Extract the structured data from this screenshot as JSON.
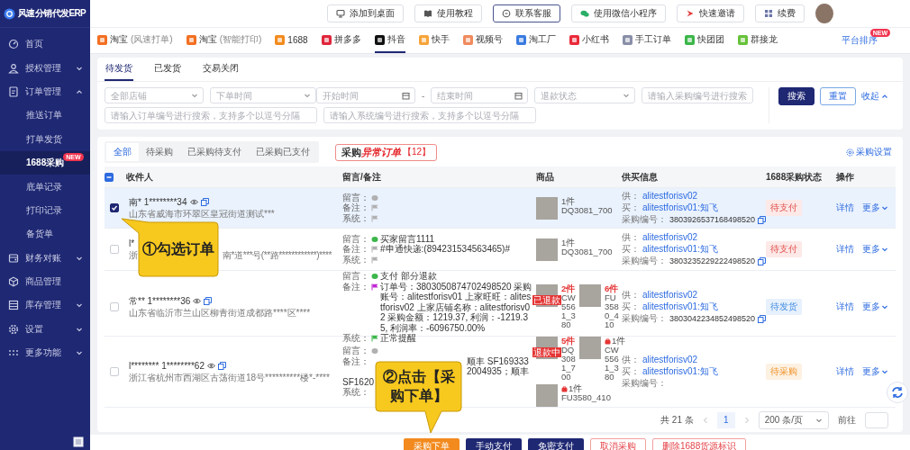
{
  "sidebar": {
    "logo": "风速分销代发ERP",
    "items": [
      {
        "label": "首页",
        "selected": false
      },
      {
        "label": "授权管理",
        "selected": false,
        "expanded": false
      },
      {
        "label": "订单管理",
        "selected": false,
        "expanded": true,
        "children": [
          {
            "label": "推送订单",
            "selected": false
          },
          {
            "label": "打单发货",
            "selected": false
          },
          {
            "label": "1688采购",
            "selected": true,
            "badge": "NEW"
          },
          {
            "label": "底单记录",
            "selected": false
          },
          {
            "label": "打印记录",
            "selected": false
          },
          {
            "label": "备货单",
            "selected": false
          }
        ]
      },
      {
        "label": "财务对账",
        "selected": false,
        "expanded": false
      },
      {
        "label": "商品管理",
        "selected": false
      },
      {
        "label": "库存管理",
        "selected": false,
        "expanded": false
      },
      {
        "label": "设置",
        "selected": false,
        "expanded": false
      },
      {
        "label": "更多功能",
        "selected": false,
        "expanded": false
      }
    ]
  },
  "top_buttons": [
    {
      "label": "添加到桌面",
      "selected": false
    },
    {
      "label": "使用教程",
      "selected": false
    },
    {
      "label": "联系客服",
      "selected": true
    },
    {
      "label": "使用微信小程序",
      "selected": false
    },
    {
      "label": "快速邀请",
      "selected": false
    },
    {
      "label": "续费",
      "selected": false
    }
  ],
  "platforms": [
    {
      "label": "淘宝",
      "sub": "(风速打单)",
      "color": "#f36f21",
      "selected": false
    },
    {
      "label": "淘宝",
      "sub": "(智能打印)",
      "color": "#f36f21",
      "selected": false
    },
    {
      "label": "1688",
      "color": "#f38b1e",
      "selected": false
    },
    {
      "label": "拼多多",
      "color": "#e0263c",
      "selected": false
    },
    {
      "label": "抖音",
      "color": "#111111",
      "selected": true
    },
    {
      "label": "快手",
      "color": "#f7a43a",
      "selected": false
    },
    {
      "label": "视频号",
      "color": "#f08a5d",
      "selected": false
    },
    {
      "label": "淘工厂",
      "color": "#3a7be0",
      "selected": false
    },
    {
      "label": "小红书",
      "color": "#ea2a3a",
      "selected": false
    },
    {
      "label": "手工订单",
      "color": "#8a8fa8",
      "selected": false
    },
    {
      "label": "快团团",
      "color": "#3cb64a",
      "selected": false
    },
    {
      "label": "群接龙",
      "color": "#67c23a",
      "selected": false
    }
  ],
  "platform_sort": {
    "label": "平台排序",
    "badge": "NEW"
  },
  "order_tabs": [
    {
      "label": "待发货",
      "selected": true
    },
    {
      "label": "已发货",
      "selected": false
    },
    {
      "label": "交易关闭",
      "selected": false
    }
  ],
  "filters": {
    "store": {
      "placeholder": "全部店铺"
    },
    "time_type": {
      "placeholder": "下单时间"
    },
    "start": {
      "placeholder": "开始时间"
    },
    "separator": "-",
    "end": {
      "placeholder": "结束时间"
    },
    "refund": {
      "placeholder": "退款状态"
    },
    "purchase_no": {
      "placeholder": "请输入采购编号进行搜索"
    },
    "order_no": {
      "placeholder": "请输入订单编号进行搜索，支持多个以逗号分隔"
    },
    "system_no": {
      "placeholder": "请输入系统编号进行搜索，支持多个以逗号分隔"
    },
    "search": "搜索",
    "reset": "重置",
    "collapse": "收起"
  },
  "status_tabs": [
    {
      "label": "全部",
      "selected": true
    },
    {
      "label": "待采购",
      "selected": false
    },
    {
      "label": "已采购待支付",
      "selected": false
    },
    {
      "label": "已采购已支付",
      "selected": false
    }
  ],
  "abnormal": {
    "title": "采购",
    "title_highlight": "异常订单",
    "count": "【12】"
  },
  "purchase_settings": "采购设置",
  "table": {
    "select_all": {
      "indeterminate": true
    },
    "columns": [
      "收件人",
      "留言/备注",
      "商品",
      "供买信息",
      "1688采购状态",
      "操作"
    ],
    "rows": [
      {
        "checked": true,
        "recipient": {
          "name": "南* 1********34",
          "address": "山东省威海市环翠区皇冠街道测试***"
        },
        "remarks": [
          {
            "label": "留言：",
            "kind": "message",
            "color": "#b0b0b0"
          },
          {
            "label": "备注：",
            "kind": "flag",
            "color": "#b0b0b0"
          },
          {
            "label": "系统：",
            "kind": "flag",
            "color": "#b0b0b0"
          }
        ],
        "products": [
          {
            "qty": "1件",
            "sku": "DQ3081_700",
            "highlight": false
          }
        ],
        "supplier": {
          "supply_label": "供：",
          "supply": "alitestforisv02",
          "buy_label": "买：",
          "buy": "alitestforisv01:知飞",
          "no_label": "采购编号：",
          "no": "3803926537168498520"
        },
        "status": {
          "label": "待支付",
          "kind": "pending_pay"
        },
        "actions": {
          "detail": "详情",
          "more": "更多"
        }
      },
      {
        "checked": false,
        "recipient": {
          "name": "l*",
          "address": "浙",
          "address_rest": "南*道***号(**路************)****"
        },
        "remarks": [
          {
            "label": "留言：",
            "kind": "message",
            "color": "#3cb64a",
            "text": "买家留言1111"
          },
          {
            "label": "备注：",
            "kind": "flag",
            "color": "#b0b0b0",
            "text": "#申通快递:(894231534563465)#"
          },
          {
            "label": "系统：",
            "kind": "flag",
            "color": "#b0b0b0"
          }
        ],
        "products": [
          {
            "qty": "1件",
            "sku": "DQ3081_700",
            "highlight": false
          }
        ],
        "supplier": {
          "supply_label": "供：",
          "supply": "alitestforisv02",
          "buy_label": "买：",
          "buy": "alitestforisv01:知飞",
          "no_label": "采购编号：",
          "no": "3803235229222498520"
        },
        "status": {
          "label": "待支付",
          "kind": "pending_pay"
        },
        "actions": {
          "detail": "详情",
          "more": "更多"
        }
      },
      {
        "checked": false,
        "recipient": {
          "name": "常** 1********36",
          "address": "山东省临沂市兰山区柳青街道成都路****区****"
        },
        "remarks": [
          {
            "label": "留言：",
            "kind": "message",
            "color": "#3cb64a",
            "text": "支付 部分退款"
          },
          {
            "label": "备注：",
            "kind": "flag",
            "color": "#c026d3",
            "text": "订单号：3803050874702498520 采购账号：alitestforisv01 上家旺旺：alitestforisv02 上家店铺名称：alitestforisv02 采购金额：1219.37, 利润：-1219.35, 利润率：-6096750.00%"
          },
          {
            "label": "系统：",
            "kind": "flag",
            "color": "#3cb64a",
            "text": "正常提醒"
          }
        ],
        "products": [
          {
            "badge": "已退款",
            "qty": "2件",
            "sku": "CW5561_380",
            "highlight": true
          },
          {
            "qty": "6件",
            "sku": "FU3580_410",
            "highlight": true
          }
        ],
        "supplier": {
          "supply_label": "供：",
          "supply": "alitestforisv02",
          "buy_label": "买：",
          "buy": "alitestforisv01:知飞",
          "no_label": "采购编号：",
          "no": "3803042234852498520"
        },
        "status": {
          "label": "待发货",
          "kind": "pending_ship"
        },
        "actions": {
          "detail": "详情",
          "more": "更多"
        }
      },
      {
        "checked": false,
        "recipient": {
          "name": "l******** 1********62",
          "address": "浙江省杭州市西湖区古荡街道18号**********楼*-****"
        },
        "remarks": [
          {
            "label": "留言：",
            "kind": "message",
            "color": "#b0b0b0"
          },
          {
            "label": "备注：",
            "kind": "plain",
            "text_rest": "顺丰 SF1693332004935；顺丰"
          },
          {
            "kind": "plain",
            "text": "SF1620"
          },
          {
            "label": "系统：",
            "kind": "plain"
          }
        ],
        "products": [
          {
            "badge": "退款中",
            "qty": "5件",
            "sku": "DQ3081_700",
            "highlight": true
          },
          {
            "warning": true,
            "qty": "1件",
            "sku": "CW5561_380",
            "highlight": false
          },
          {
            "warning": true,
            "qty": "1件",
            "sku": "FU3580_410",
            "highlight": false
          }
        ],
        "supplier": {
          "supply_label": "供：",
          "supply": "alitestforisv02",
          "buy_label": "买：",
          "buy": "alitestforisv01:知飞",
          "no_label": "采购编号："
        },
        "status": {
          "label": "待采购",
          "kind": "pending_purchase"
        },
        "actions": {
          "detail": "详情",
          "more": "更多"
        }
      }
    ]
  },
  "pagination": {
    "total": "共 21 条",
    "page": "1",
    "page_size": "200 条/页",
    "goto": "前往"
  },
  "actions": [
    {
      "label": "采购下单",
      "kind": "primary"
    },
    {
      "label": "手动支付",
      "kind": "dark"
    },
    {
      "label": "免密支付",
      "kind": "dark"
    },
    {
      "label": "取消采购",
      "kind": "danger"
    },
    {
      "label": "删除1688货源标识",
      "kind": "danger"
    }
  ],
  "callouts": [
    {
      "text": "①勾选订单"
    },
    {
      "text": "②点击【采购下单】"
    }
  ]
}
